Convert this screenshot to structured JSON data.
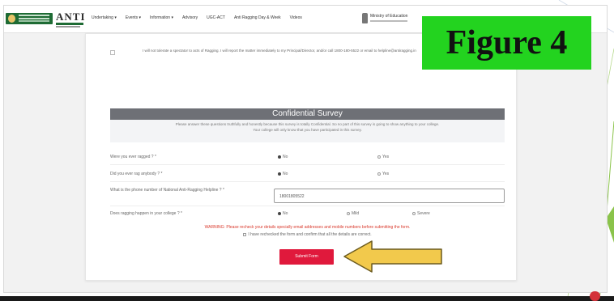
{
  "nav": {
    "logo_text": "ANTI",
    "items": [
      "Undertaking ▾",
      "Events ▾",
      "Information ▾",
      "Advisory",
      "UGC-ACT",
      "Anti Ragging Day & Week",
      "Videos"
    ],
    "ministry": "Ministry of Education"
  },
  "pledge": {
    "text": "I will not tolerate a spectator to acts of Ragging. I will report the matter immediately to my Principal/Director, and/or call 1800-180-5522 or email to helpline@antiragging.in"
  },
  "survey": {
    "heading": "Confidential Survey",
    "note_line1": "Please answer these questions truthfully and honestly because this survey is totally Confidential. So no part of this survey is going to show anything to your college.",
    "note_line2": "Your college will only know that you have participated in this survey.",
    "questions": [
      {
        "label": "Were you ever ragged ? *",
        "options": [
          "No",
          "Yes"
        ]
      },
      {
        "label": "Did you ever rag anybody ? *",
        "options": [
          "No",
          "Yes"
        ]
      },
      {
        "label": "What is the phone number of National Anti-Ragging Helpline ? *",
        "value": "18001805522"
      },
      {
        "label": "Does ragging happen in your college ? *",
        "options": [
          "No",
          "Mild",
          "Severe"
        ]
      }
    ],
    "warning": "WARNING: Please recheck your details specially email addresses and mobile numbers before submitting the form.",
    "confirm": "I have rechecked the form and confirm that all the details are correct.",
    "submit": "Submit Form"
  },
  "figure_label": "Figure 4",
  "colors": {
    "survey_header": "#6e7076",
    "submit": "#e0193c",
    "figure_label_bg": "#23d31f",
    "arrow": "#f2c94c",
    "warning": "#d9382b"
  },
  "icons": [
    "emblem-icon",
    "radio-icon",
    "checkbox-icon",
    "arrow-icon"
  ]
}
